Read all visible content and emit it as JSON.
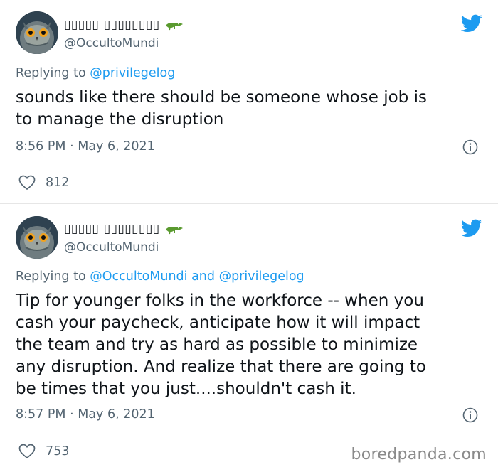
{
  "colors": {
    "twitter_blue": "#1d9bf0",
    "text_primary": "#0f1419",
    "text_secondary": "#536471",
    "divider": "#dfe3e6"
  },
  "tweets": [
    {
      "display_name": "▯▯▯▯▯ ▯▯▯▯▯▯▯▯",
      "emoji_icon": "crocodile-icon",
      "handle": "@OccultoMundi",
      "reply_prefix": "Replying to ",
      "reply_mentions": "@privilegelog",
      "text": "sounds like there should be someone whose job is\nto manage the disruption",
      "timestamp": "8:56 PM · May 6, 2021",
      "likes": "812"
    },
    {
      "display_name": "▯▯▯▯▯ ▯▯▯▯▯▯▯▯",
      "emoji_icon": "crocodile-icon",
      "handle": "@OccultoMundi",
      "reply_prefix": "Replying to ",
      "reply_mentions": "@OccultoMundi and @privilegelog",
      "text": "Tip for younger folks in the workforce -- when you\ncash your paycheck, anticipate how it will impact\nthe team and try as hard as possible to minimize\nany disruption. And realize that there are going to\nbe times that you just....shouldn't cash it.",
      "timestamp": "8:57 PM · May 6, 2021",
      "likes": "753"
    }
  ],
  "watermark": "boredpanda.com"
}
